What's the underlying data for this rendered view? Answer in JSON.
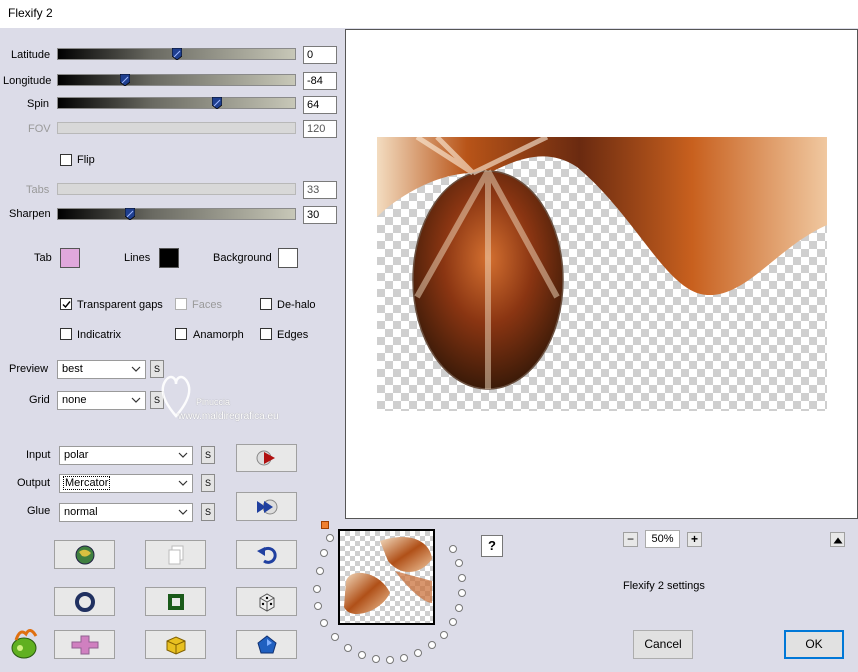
{
  "window": {
    "title": "Flexify 2"
  },
  "sliders": {
    "latitude": {
      "label": "Latitude",
      "value": "0",
      "fraction": 0.5
    },
    "longitude": {
      "label": "Longitude",
      "value": "-84",
      "fraction": 0.27
    },
    "spin": {
      "label": "Spin",
      "value": "64",
      "fraction": 0.67
    },
    "fov": {
      "label": "FOV",
      "value": "120",
      "fraction": 0
    },
    "tabs": {
      "label": "Tabs",
      "value": "33",
      "fraction": 0
    },
    "sharpen": {
      "label": "Sharpen",
      "value": "30",
      "fraction": 0.3
    }
  },
  "flip": {
    "label": "Flip",
    "checked": false
  },
  "colors": {
    "tab": {
      "label": "Tab",
      "color": "#e0a8dc"
    },
    "lines": {
      "label": "Lines",
      "color": "#000000"
    },
    "background": {
      "label": "Background",
      "color": "#ffffff"
    }
  },
  "options": {
    "transparent_gaps": {
      "label": "Transparent gaps",
      "checked": true
    },
    "faces": {
      "label": "Faces",
      "checked": false,
      "disabled": true
    },
    "de_halo": {
      "label": "De-halo",
      "checked": false
    },
    "indicatrix": {
      "label": "Indicatrix",
      "checked": false
    },
    "anamorph": {
      "label": "Anamorph",
      "checked": false
    },
    "edges": {
      "label": "Edges",
      "checked": false
    }
  },
  "preview": {
    "label": "Preview",
    "value": "best"
  },
  "grid": {
    "label": "Grid",
    "value": "none"
  },
  "input": {
    "label": "Input",
    "value": "polar"
  },
  "output": {
    "label": "Output",
    "value": "Mercator"
  },
  "glue": {
    "label": "Glue",
    "value": "normal"
  },
  "s_label": "S",
  "watermark": {
    "line1": "Pinuccia",
    "line2": "www.maldiregrafica.eu"
  },
  "zoom": {
    "value": "50%",
    "minus": "−",
    "plus": "+"
  },
  "settings_label": "Flexify 2 settings",
  "help_label": "?",
  "buttons": {
    "cancel": "Cancel",
    "ok": "OK"
  },
  "icons": {
    "play": "play-arrow-icon",
    "forward": "fast-forward-icon",
    "undo": "undo-icon",
    "globe": "globe-icon",
    "copy": "copy-icon",
    "ring": "ring-icon",
    "frame": "frame-icon",
    "dice": "dice-icon",
    "cross": "cross-icon",
    "cube": "cube-icon",
    "pentagon": "pentagon-icon",
    "logo": "flexify-logo-icon"
  }
}
